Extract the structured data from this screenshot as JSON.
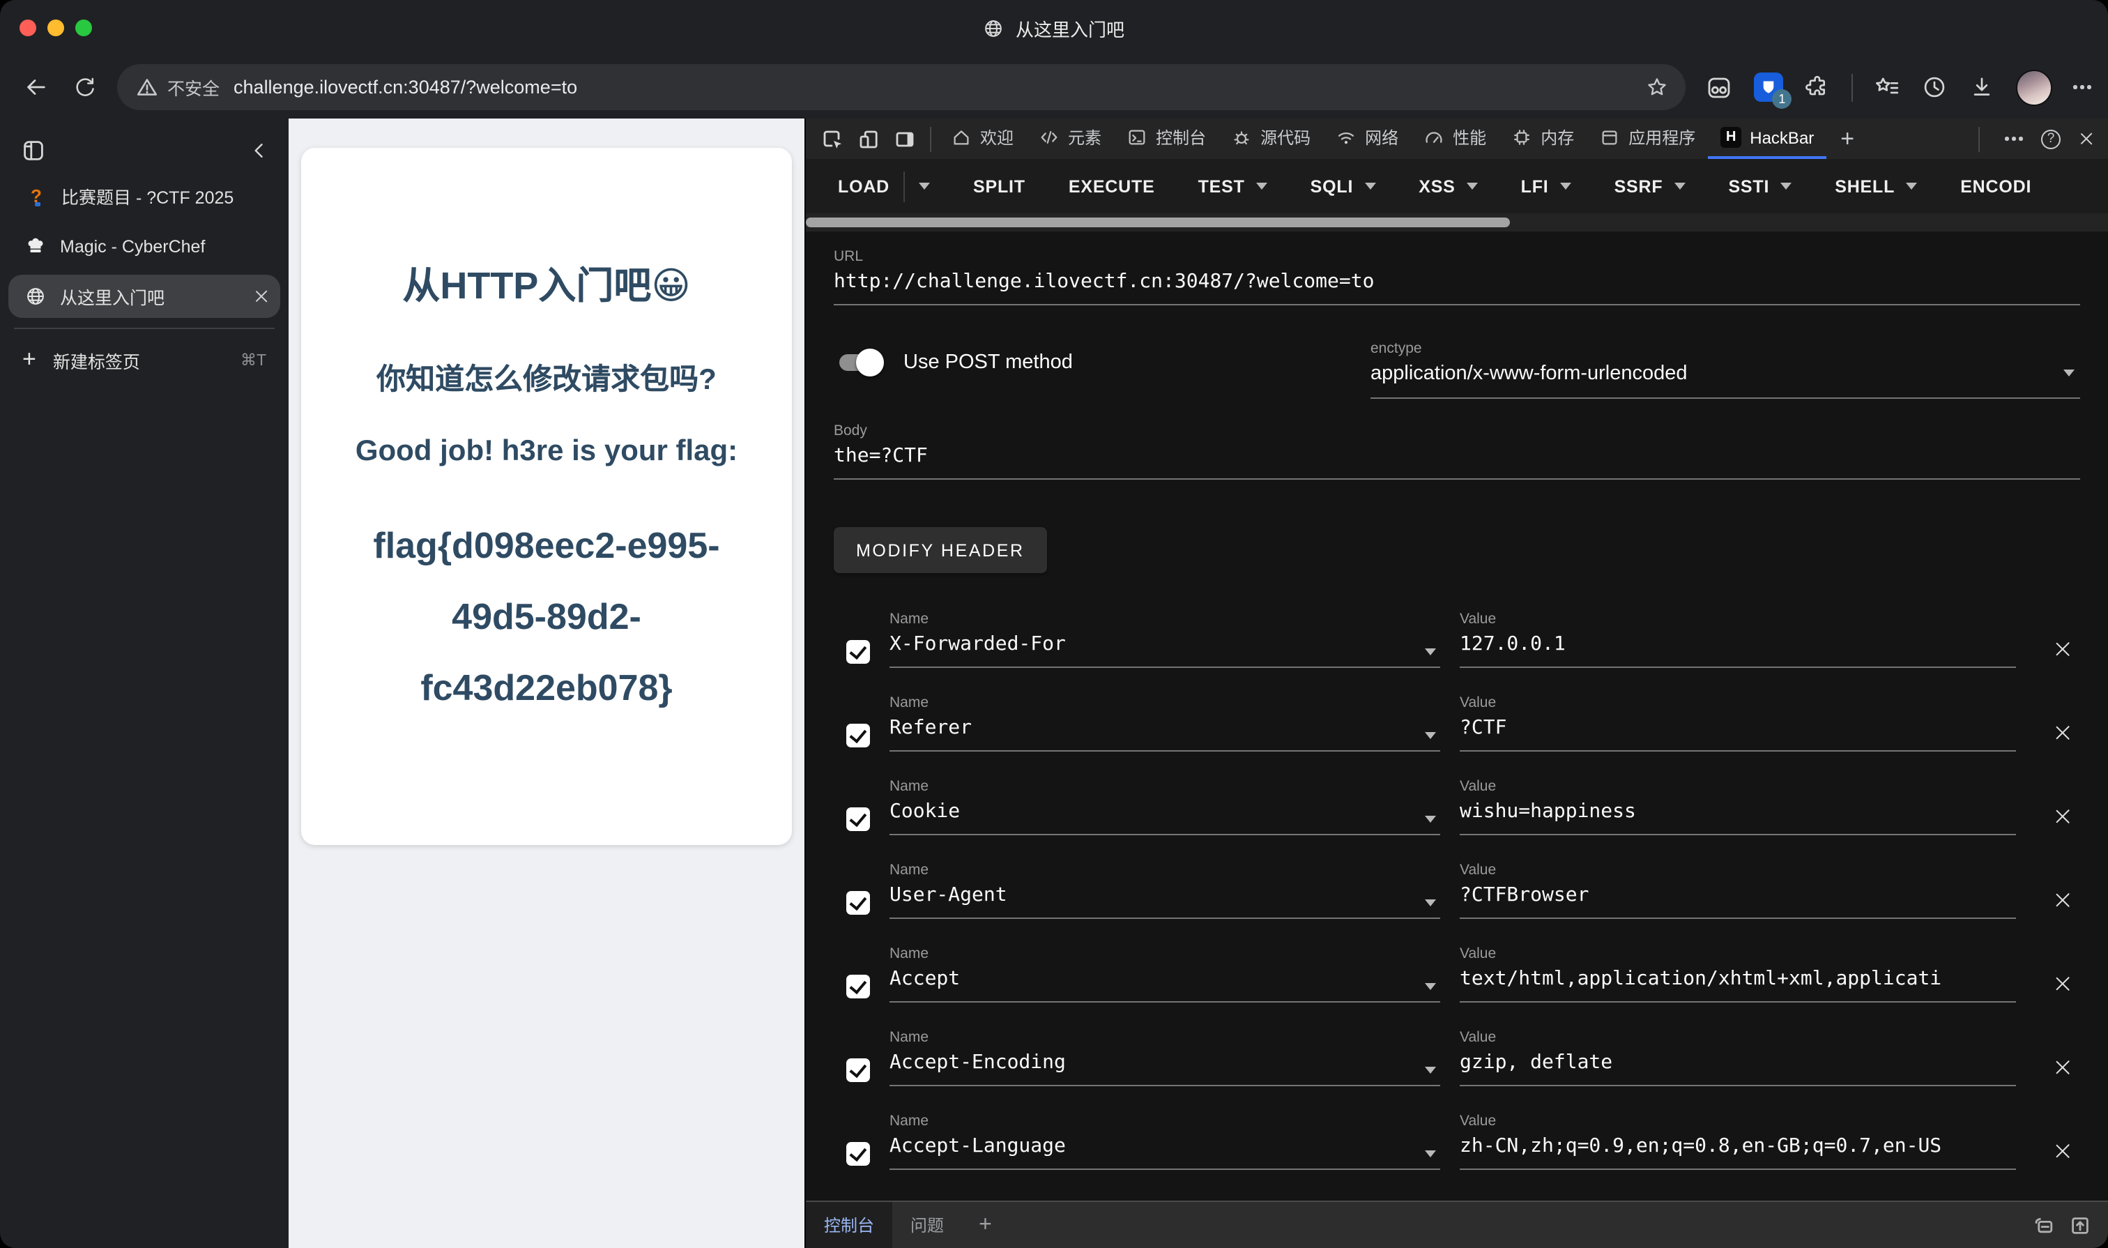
{
  "window": {
    "title": "从这里入门吧"
  },
  "toolbar": {
    "security_label": "不安全",
    "url": "challenge.ilovectf.cn:30487/?welcome=to",
    "extension_badge": "1"
  },
  "sidebar": {
    "tabs": [
      {
        "title": "比赛题目 - ?CTF 2025",
        "fav_q": true
      },
      {
        "title": "Magic - CyberChef",
        "fav_chef": true
      },
      {
        "title": "从这里入门吧",
        "fav_globe": true,
        "active": true,
        "closable": true
      }
    ],
    "new_tab_label": "新建标签页",
    "new_tab_shortcut": "⌘T"
  },
  "page": {
    "heading": "从HTTP入门吧😀",
    "question": "你知道怎么修改请求包吗?",
    "subheading": "Good job! h3re is your flag:",
    "flag": "flag{d098eec2-e995-49d5-89d2-fc43d22eb078}",
    "text_color": "#2f4b63"
  },
  "devtools": {
    "tabs": [
      {
        "label": "欢迎",
        "ic_home": true
      },
      {
        "label": "元素",
        "ic_elements": true
      },
      {
        "label": "控制台",
        "ic_console": true
      },
      {
        "label": "源代码",
        "ic_sources": true
      },
      {
        "label": "网络",
        "ic_network": true
      },
      {
        "label": "性能",
        "ic_perf": true
      },
      {
        "label": "内存",
        "ic_memory": true
      },
      {
        "label": "应用程序",
        "ic_app": true
      },
      {
        "label": "HackBar",
        "ic_hackbar": true,
        "active": true
      }
    ],
    "active_tab_color": "#4176f5"
  },
  "hackbar": {
    "menu": [
      {
        "label": "LOAD",
        "split": true
      },
      {
        "label": "SPLIT"
      },
      {
        "label": "EXECUTE"
      },
      {
        "label": "TEST",
        "caret": true
      },
      {
        "label": "SQLI",
        "caret": true
      },
      {
        "label": "XSS",
        "caret": true
      },
      {
        "label": "LFI",
        "caret": true
      },
      {
        "label": "SSRF",
        "caret": true
      },
      {
        "label": "SSTI",
        "caret": true
      },
      {
        "label": "SHELL",
        "caret": true
      },
      {
        "label": "ENCODI"
      }
    ],
    "url_label": "URL",
    "url_value": "http://challenge.ilovectf.cn:30487/?welcome=to",
    "post_label": "Use POST method",
    "post_enabled": true,
    "enctype_label": "enctype",
    "enctype_value": "application/x-www-form-urlencoded",
    "body_label": "Body",
    "body_value": "the=?CTF",
    "modify_header_label": "MODIFY HEADER",
    "name_label": "Name",
    "value_label": "Value",
    "headers": [
      {
        "name": "X-Forwarded-For",
        "value": "127.0.0.1",
        "checked": true
      },
      {
        "name": "Referer",
        "value": "?CTF",
        "checked": true
      },
      {
        "name": "Cookie",
        "value": "wishu=happiness",
        "checked": true
      },
      {
        "name": "User-Agent",
        "value": "?CTFBrowser",
        "checked": true
      },
      {
        "name": "Accept",
        "value": "text/html,application/xhtml+xml,applicati",
        "checked": true
      },
      {
        "name": "Accept-Encoding",
        "value": "gzip, deflate",
        "checked": true
      },
      {
        "name": "Accept-Language",
        "value": "zh-CN,zh;q=0.9,en;q=0.8,en-GB;q=0.7,en-US",
        "checked": true
      }
    ]
  },
  "drawer": {
    "tabs": [
      {
        "label": "控制台",
        "active": true
      },
      {
        "label": "问题"
      }
    ]
  }
}
